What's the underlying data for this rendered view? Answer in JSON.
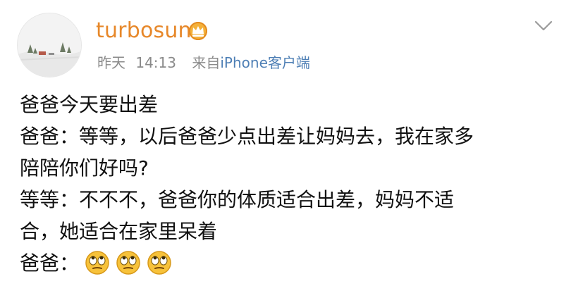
{
  "post": {
    "author": {
      "username": "turbosun",
      "badge_icon": "crown-icon"
    },
    "meta": {
      "day": "昨天",
      "time": "14:13",
      "via_prefix": "来自",
      "device": "iPhone客户端"
    },
    "menu_icon": "chevron-down-icon",
    "content": {
      "line1": "爸爸今天要出差",
      "line2": "爸爸：等等，以后爸爸少点出差让妈妈去，我在家多",
      "line3": "陪陪你们好吗?",
      "line4": "等等：不不不，爸爸你的体质适合出差，妈妈不适",
      "line5": "合，她适合在家里呆着",
      "line6": "爸爸：",
      "emojis": [
        "eye-roll-emoji",
        "eye-roll-emoji",
        "eye-roll-emoji"
      ]
    }
  },
  "colors": {
    "username": "#e7882a",
    "meta": "#8a8a8a",
    "device_link": "#4e7fb5",
    "text": "#111111",
    "emoji_face": "#f7c23a"
  }
}
